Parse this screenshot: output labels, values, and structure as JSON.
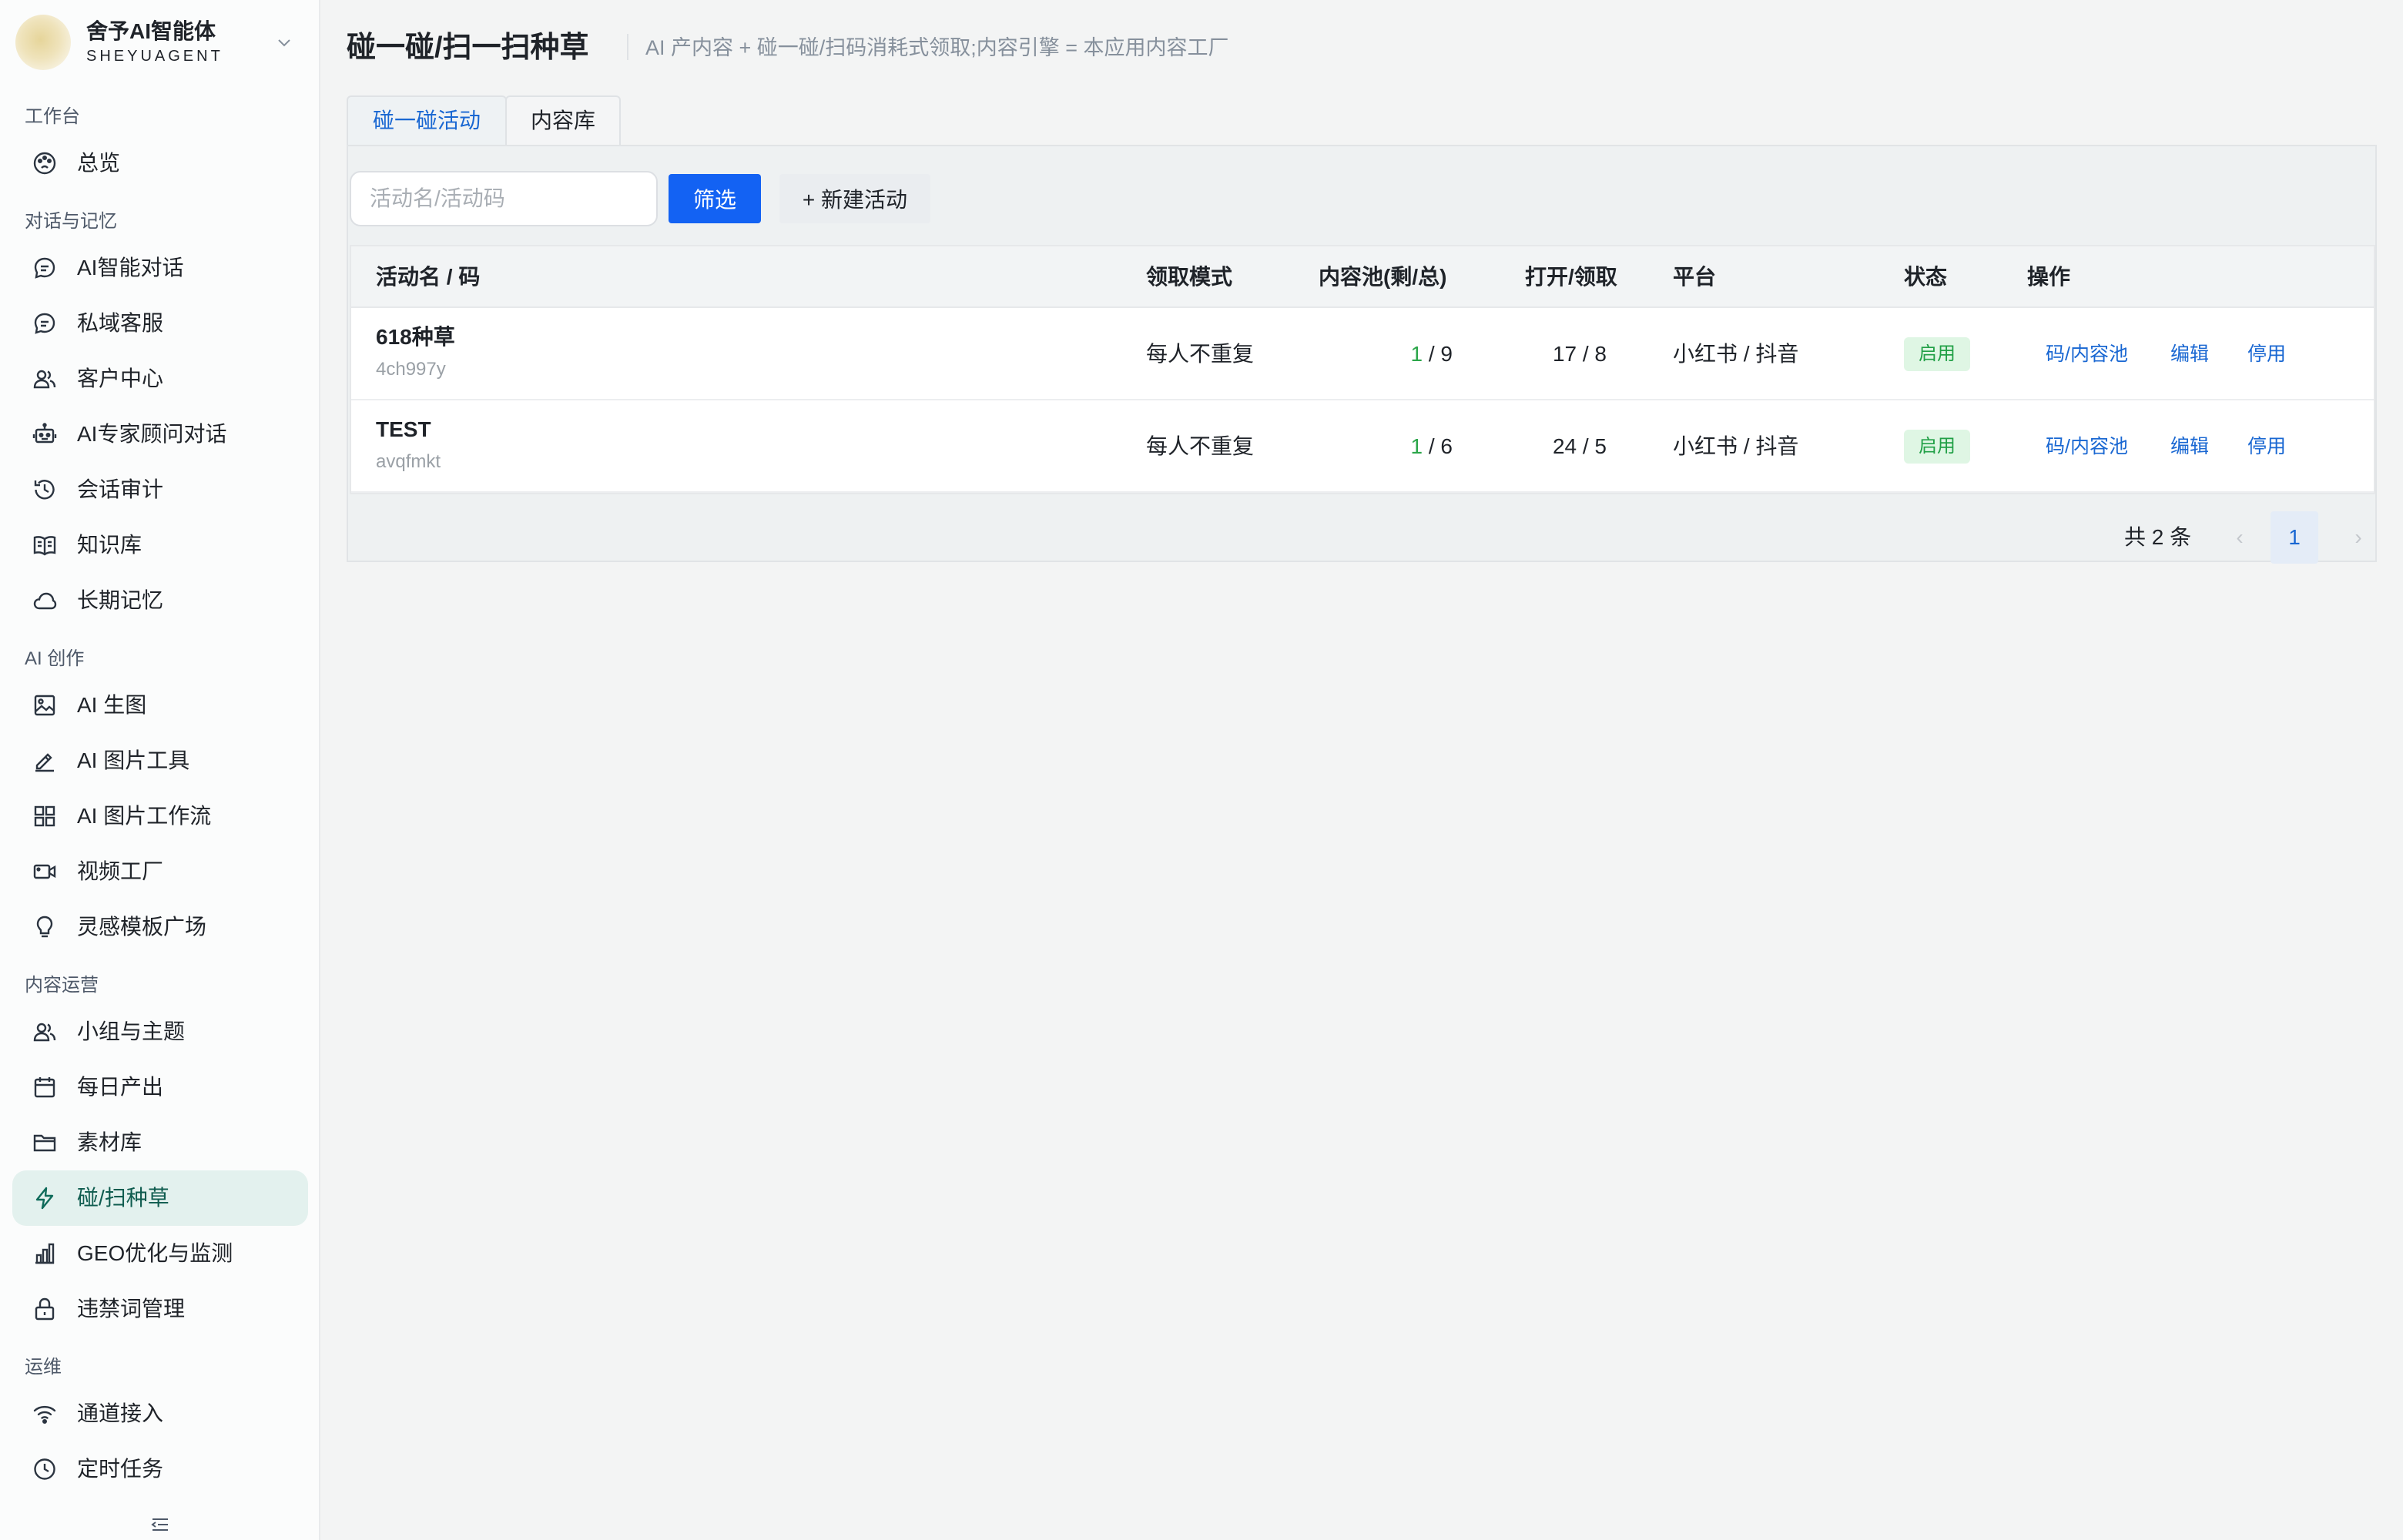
{
  "brand": {
    "name": "舍予AI智能体",
    "sub": "SHEYUAGENT"
  },
  "sidebar": {
    "groups": [
      {
        "title": "工作台"
      },
      {
        "title": "对话与记忆"
      },
      {
        "title": "AI 创作"
      },
      {
        "title": "内容运营"
      },
      {
        "title": "运维"
      }
    ],
    "items": [
      {
        "label": "总览",
        "icon": "palette-icon"
      },
      {
        "label": "AI智能对话",
        "icon": "chat-icon"
      },
      {
        "label": "私域客服",
        "icon": "chat-icon"
      },
      {
        "label": "客户中心",
        "icon": "users-icon"
      },
      {
        "label": "AI专家顾问对话",
        "icon": "robot-icon"
      },
      {
        "label": "会话审计",
        "icon": "history-icon"
      },
      {
        "label": "知识库",
        "icon": "book-icon"
      },
      {
        "label": "长期记忆",
        "icon": "cloud-icon"
      },
      {
        "label": "AI 生图",
        "icon": "image-icon"
      },
      {
        "label": "AI 图片工具",
        "icon": "pen-icon"
      },
      {
        "label": "AI 图片工作流",
        "icon": "grid-icon"
      },
      {
        "label": "视频工厂",
        "icon": "video-icon"
      },
      {
        "label": "灵感模板广场",
        "icon": "bulb-icon"
      },
      {
        "label": "小组与主题",
        "icon": "users-icon"
      },
      {
        "label": "每日产出",
        "icon": "calendar-icon"
      },
      {
        "label": "素材库",
        "icon": "folder-icon"
      },
      {
        "label": "碰/扫种草",
        "icon": "lightning-icon",
        "active": true
      },
      {
        "label": "GEO优化与监测",
        "icon": "bar-chart-icon"
      },
      {
        "label": "违禁词管理",
        "icon": "lock-icon"
      },
      {
        "label": "通道接入",
        "icon": "wifi-icon"
      },
      {
        "label": "定时任务",
        "icon": "clock-icon"
      }
    ]
  },
  "header": {
    "title": "碰一碰/扫一扫种草",
    "subtitle": "AI 产内容 + 碰一碰/扫码消耗式领取;内容引擎 = 本应用内容工厂"
  },
  "tabs": [
    {
      "label": "碰一碰活动",
      "active": true
    },
    {
      "label": "内容库",
      "active": false
    }
  ],
  "toolbar": {
    "search_placeholder": "活动名/活动码",
    "search_value": "",
    "filter_label": "筛选",
    "new_label": "+ 新建活动"
  },
  "table": {
    "columns": [
      "活动名 / 码",
      "领取模式",
      "内容池(剩/总)",
      "打开/领取",
      "平台",
      "状态",
      "操作"
    ],
    "rows": [
      {
        "name": "618种草",
        "code": "4ch997y",
        "mode": "每人不重复",
        "pool_remain": "1",
        "pool_total": "/ 9",
        "open_claim": "17 / 8",
        "platform": "小红书 / 抖音",
        "status": "启用",
        "ops": [
          "码/内容池",
          "编辑",
          "停用"
        ]
      },
      {
        "name": "TEST",
        "code": "avqfmkt",
        "mode": "每人不重复",
        "pool_remain": "1",
        "pool_total": "/ 6",
        "open_claim": "24 / 5",
        "platform": "小红书 / 抖音",
        "status": "启用",
        "ops": [
          "码/内容池",
          "编辑",
          "停用"
        ]
      }
    ]
  },
  "pagination": {
    "total": "共 2 条",
    "current": "1",
    "prev": "‹",
    "next": "›"
  },
  "colors": {
    "accent": "#1362f3",
    "link": "#1967d2",
    "status_green": "#21a046",
    "active_nav_bg": "#e3f1ee"
  }
}
